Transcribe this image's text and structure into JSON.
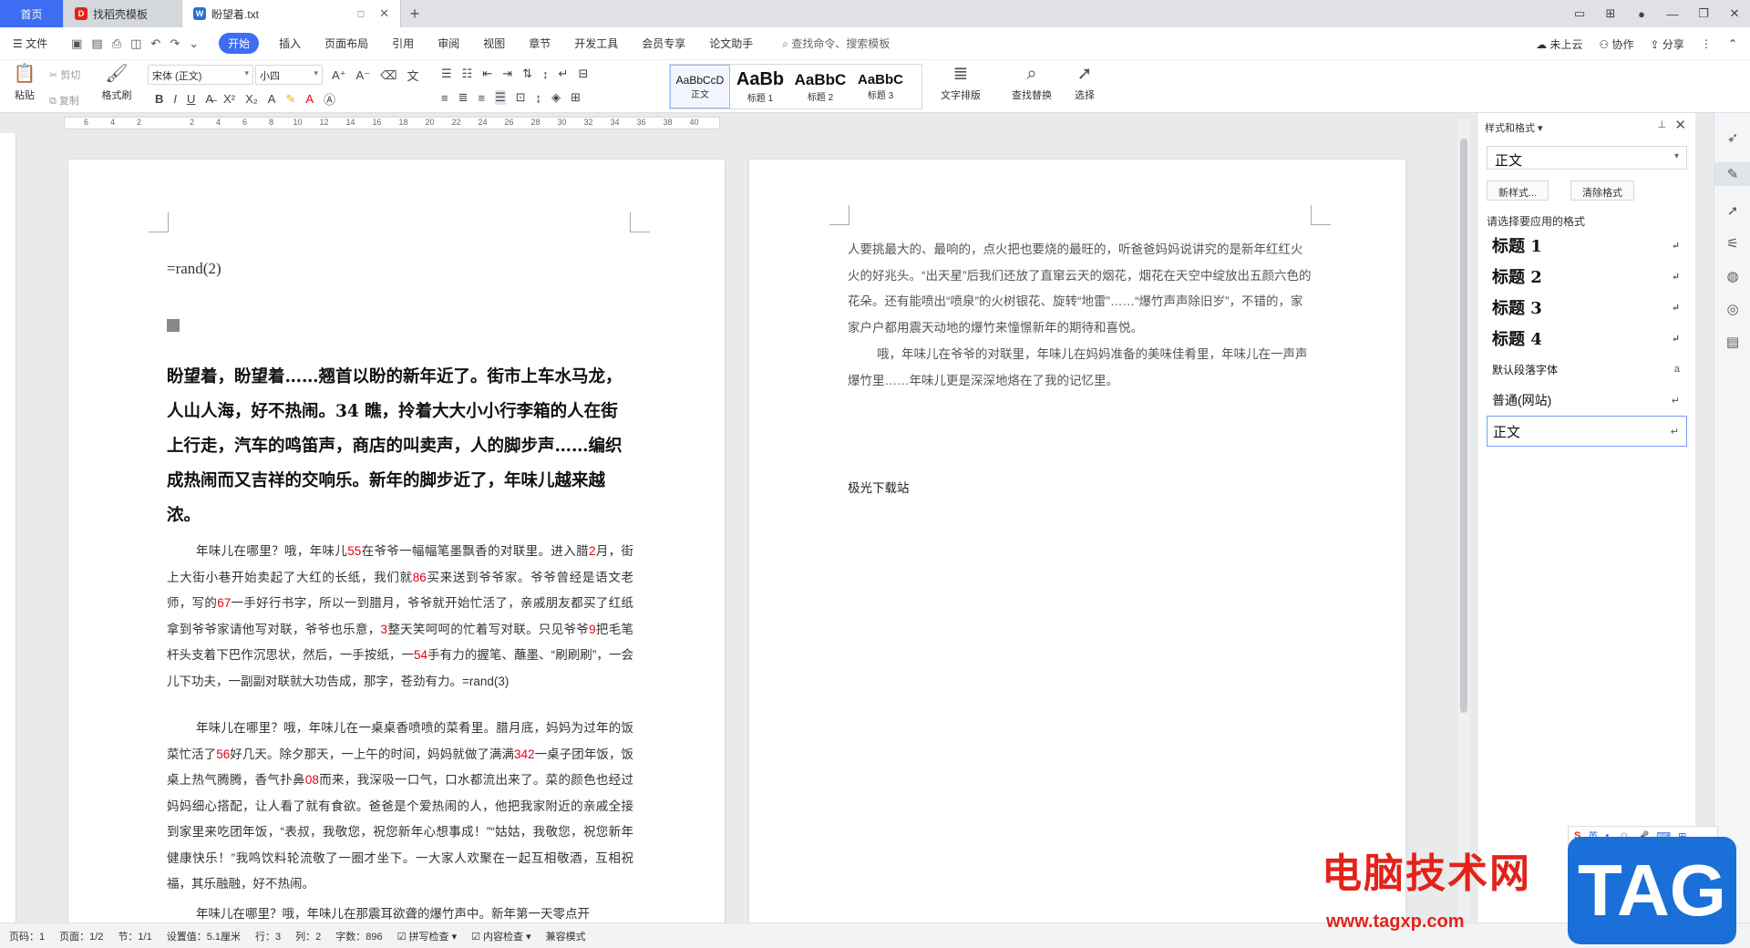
{
  "tabs": {
    "home": "首页",
    "t1": "找稻壳模板",
    "t2": "盼望着.txt",
    "new_tab": "+"
  },
  "menu": {
    "file": "文件",
    "items": [
      "开始",
      "插入",
      "页面布局",
      "引用",
      "审阅",
      "视图",
      "章节",
      "开发工具",
      "会员专享",
      "论文助手"
    ],
    "search": "查找命令、搜索模板",
    "right": [
      "未上云",
      "协作",
      "分享"
    ]
  },
  "ribbon": {
    "paste": "粘贴",
    "cut": "剪切",
    "copy": "复制",
    "format_painter": "格式刷",
    "font_name": "宋体 (正文)",
    "font_size": "小四",
    "styles": [
      {
        "preview": "AaBbCcD",
        "label": "正文"
      },
      {
        "preview": "AaBb",
        "label": "标题 1"
      },
      {
        "preview": "AaBbC",
        "label": "标题 2"
      },
      {
        "preview": "AaBbC",
        "label": "标题 3"
      }
    ],
    "text_layout": "文字排版",
    "find_replace": "查找替换",
    "select": "选择"
  },
  "ruler": {
    "numbers": [
      "6",
      "4",
      "2",
      "",
      "2",
      "4",
      "6",
      "8",
      "10",
      "12",
      "14",
      "16",
      "18",
      "20",
      "22",
      "24",
      "26",
      "28",
      "30",
      "32",
      "34",
      "36",
      "38",
      "40"
    ]
  },
  "page1": {
    "rand": "=rand(2)",
    "heading": "盼望着，盼望着……翘首以盼的新年近了。街市上车水马龙，人山人海，好不热闹。34 瞧，拎着大大小小行李箱的人在街上行走，汽车的鸣笛声，商店的叫卖声，人的脚步声……编织成热闹而又吉祥的交响乐。新年的脚步近了，年味儿越来越浓。",
    "b1": [
      {
        "t": "年味儿在哪里？哦，年味儿"
      },
      {
        "t": "55",
        "r": true
      },
      {
        "t": "在爷爷一幅幅笔墨飘香的对联里。进入腊"
      },
      {
        "t": "2",
        "r": true
      },
      {
        "t": "月，街上大街小巷开始卖起了大红的长纸，我们就"
      },
      {
        "t": "86",
        "r": true
      },
      {
        "t": "买来送到爷爷家。爷爷曾经是语文老师，写的"
      },
      {
        "t": "67",
        "r": true
      },
      {
        "t": "一手好行书字，所以一到腊月，爷爷就开始忙活了，亲戚朋友都买了红纸拿到爷爷家请他写对联，爷爷也乐意，"
      },
      {
        "t": "3",
        "r": true
      },
      {
        "t": "整天笑呵呵的忙着写对联。只见爷爷"
      },
      {
        "t": "9",
        "r": true
      },
      {
        "t": "把毛笔杆头支着下巴作沉思状，然后，一手按纸，一"
      },
      {
        "t": "54",
        "r": true
      },
      {
        "t": "手有力的握笔、蘸墨、“刷刷刷”，一会儿下功夫，一副副对联就大功告成，那字，苍劲有力。=rand(3)"
      }
    ],
    "b2": [
      {
        "t": "年味儿在哪里？哦，年味儿在一桌桌香喷喷的菜肴里。腊月底，妈妈为过年的饭菜忙活了"
      },
      {
        "t": "56",
        "r": true
      },
      {
        "t": "好几天。除夕那天，一上午的时间，妈妈就做了满满"
      },
      {
        "t": "342",
        "r": true
      },
      {
        "t": "一桌子团年饭，饭桌上热气腾腾，香气扑鼻"
      },
      {
        "t": "08",
        "r": true
      },
      {
        "t": "而来，我深吸一口气，口水都流出来了。菜的颜色也经过妈妈细心搭配，让人看了就有食欲。爸爸是个爱热闹的人，他把我家附近的亲戚全接到家里来吃团年饭，“表叔，我敬您，祝您新年心想事成！”“姑姑，我敬您，祝您新年健康快乐！”我鸣饮料轮流敬了一圈才坐下。一大家人欢聚在一起互相敬酒，互相祝福，其乐融融，好不热闹。"
      }
    ],
    "b3": "年味儿在哪里？哦，年味儿在那震耳欲聋的爆竹声中。新年第一天零点开"
  },
  "page2": {
    "b1": "人要挑最大的、最响的，点火把也要烧的最旺的，听爸爸妈妈说讲究的是新年红红火火的好兆头。“出天星”后我们还放了直窜云天的烟花，烟花在天空中绽放出五颜六色的花朵。还有能喷出“喷泉”的火树银花、旋转“地雷”……“爆竹声声除旧岁”，不错的，家家户户都用震天动地的爆竹来憧憬新年的期待和喜悦。",
    "b2": "哦，年味儿在爷爷的对联里，年味儿在妈妈准备的美味佳肴里，年味儿在一声声爆竹里……年味儿更是深深地烙在了我的记忆里。",
    "site": "极光下载站"
  },
  "panel": {
    "title": "样式和格式",
    "current": "正文",
    "new_style": "新样式...",
    "clear": "清除格式",
    "tip": "请选择要应用的格式",
    "styles": [
      {
        "label": "标题 1",
        "mark": "↵",
        "kind": "h"
      },
      {
        "label": "标题 2",
        "mark": "↵",
        "kind": "h"
      },
      {
        "label": "标题 3",
        "mark": "↵",
        "kind": "h"
      },
      {
        "label": "标题 4",
        "mark": "↵",
        "kind": "h"
      },
      {
        "label": "默认段落字体",
        "mark": "a",
        "kind": "small"
      },
      {
        "label": "普通(网站)",
        "mark": "↵",
        "kind": "mid"
      },
      {
        "label": "正文",
        "mark": "↵",
        "kind": "active"
      }
    ]
  },
  "status": {
    "page_no": "页码：1",
    "page": "页面：1/2",
    "section": "节：1/1",
    "setting": "设置值：5.1厘米",
    "row": "行：3",
    "col": "列：2",
    "words": "字数：896",
    "spell": "拼写检查",
    "content_check": "内容检查",
    "compat": "兼容模式"
  },
  "watermark": {
    "cn": "电脑技术网",
    "url": "www.tagxp.com",
    "tag": "TAG"
  },
  "ime": {
    "lang": "英"
  }
}
